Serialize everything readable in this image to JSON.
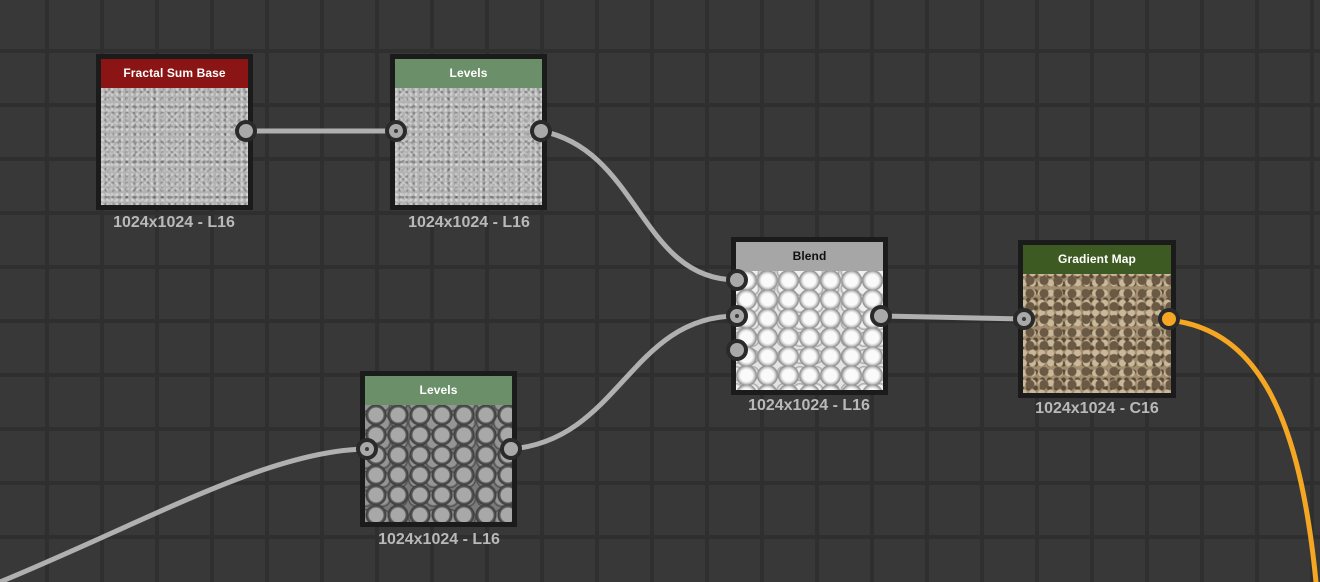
{
  "graph": {
    "nodes": [
      {
        "id": "fractal-sum-base",
        "title": "Fractal Sum Base",
        "caption": "1024x1024 - L16",
        "header_color": "#8b1414",
        "texture": "noise-gray"
      },
      {
        "id": "levels-top",
        "title": "Levels",
        "caption": "1024x1024 - L16",
        "header_color": "#6b8f68",
        "texture": "noise-gray"
      },
      {
        "id": "levels-bottom",
        "title": "Levels",
        "caption": "1024x1024 - L16",
        "header_color": "#6b8f68",
        "texture": "cells-dark"
      },
      {
        "id": "blend",
        "title": "Blend",
        "caption": "1024x1024 - L16",
        "header_color": "#a6a6a6",
        "header_text_color": "#111111",
        "texture": "cells-light"
      },
      {
        "id": "gradient-map",
        "title": "Gradient Map",
        "caption": "1024x1024 - C16",
        "header_color": "#3d5a22",
        "texture": "cells-brown"
      }
    ],
    "colors": {
      "background": "#383838",
      "grid": "#2f2f2f",
      "wire_grayscale": "#b0b0b0",
      "wire_color": "#f5a623",
      "port": "#a9a9a9",
      "port_color_output": "#f5a623"
    }
  }
}
